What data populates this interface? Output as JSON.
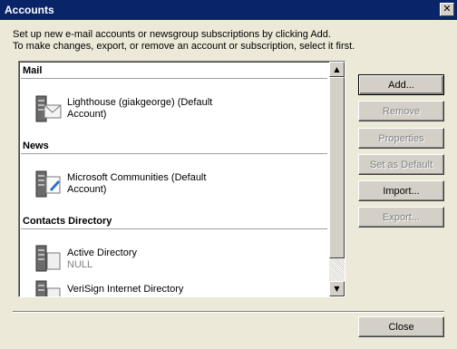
{
  "window": {
    "title": "Accounts"
  },
  "intro": {
    "line1": "Set up new e-mail accounts or newsgroup subscriptions by clicking Add.",
    "line2": "To make changes, export, or remove an account or subscription, select it first."
  },
  "sections": {
    "mail": {
      "header": "Mail",
      "account_name_line1": "Lighthouse (giakgeorge) (Default",
      "account_name_line2": "Account)"
    },
    "news": {
      "header": "News",
      "account_name_line1": "Microsoft Communities (Default",
      "account_name_line2": "Account)"
    },
    "contacts": {
      "header": "Contacts Directory",
      "item1_name": "Active Directory",
      "item1_sub": "NULL",
      "item2_name": "VeriSign Internet Directory"
    }
  },
  "buttons": {
    "add": "Add...",
    "remove": "Remove",
    "properties": "Properties",
    "set_default": "Set as Default",
    "import": "Import...",
    "export": "Export...",
    "close": "Close"
  },
  "icons": {
    "mail_account": "mail-server-icon",
    "news_account": "news-server-icon",
    "directory": "directory-server-icon"
  }
}
